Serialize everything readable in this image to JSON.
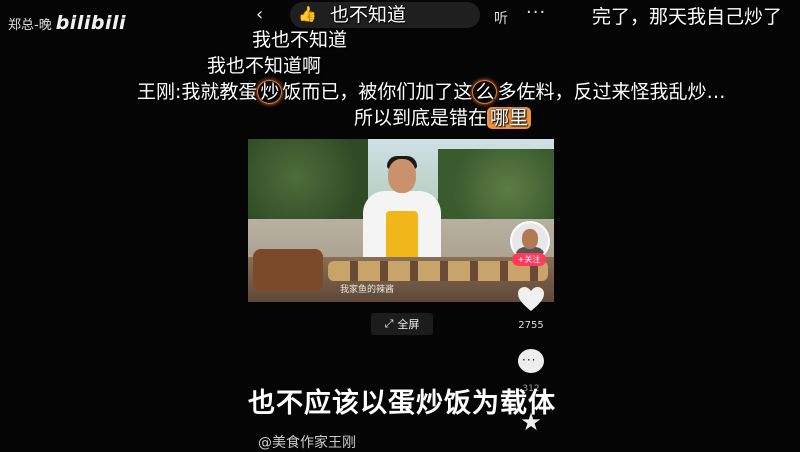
{
  "watermark": {
    "author": "郑总-晚",
    "logo": "bilibili"
  },
  "topbar": {
    "back_icon": "‹",
    "thumb_icon": "thumbs-up",
    "listen_label": "听",
    "more_icon": "···"
  },
  "danmaku": {
    "line1": "也不知道",
    "line2": "我也不知道",
    "line3": "我也不知道啊",
    "line4_pre": "王刚:我就教蛋",
    "line4_hl": "炒",
    "line4_mid": "饭而已，被你们加了这",
    "line4_hl2": "么",
    "line4_post": "多佐料，反过来怪我乱炒…",
    "line5_pre": "所以到底是错在",
    "line5_hl": "哪里",
    "top_right": "完了，那天我自己炒了"
  },
  "video": {
    "subtitle": "我家鱼的辣酱",
    "follow_label": "+关注"
  },
  "fullscreen": {
    "label": "全屏"
  },
  "actions": {
    "like_count": "2755",
    "comment_count": "312"
  },
  "caption": "也不应该以蛋炒饭为载体",
  "author_tag": "@美食作家王刚"
}
